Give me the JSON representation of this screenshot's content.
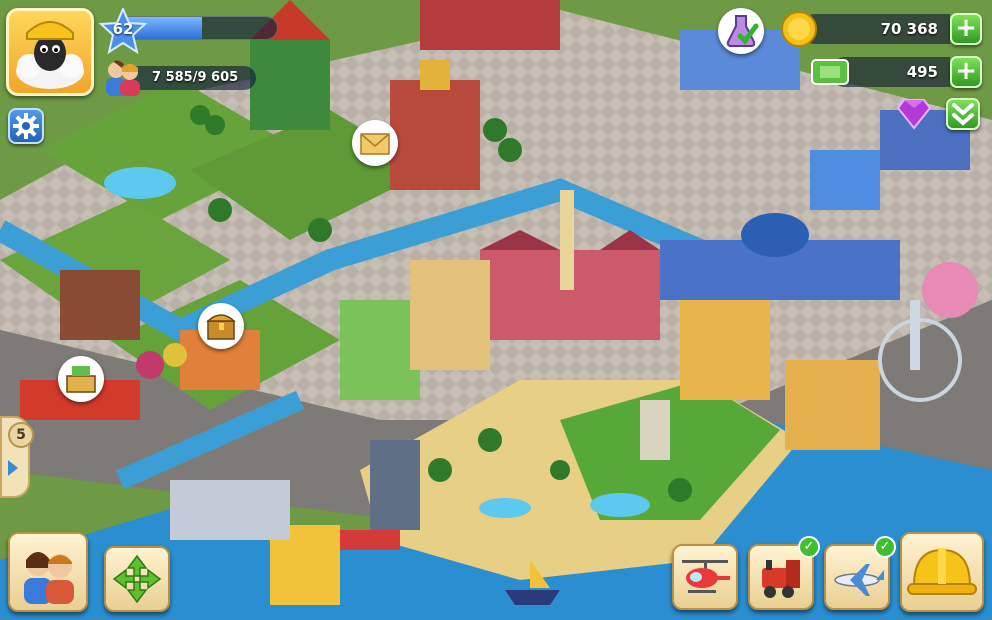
{
  "player": {
    "level": "62",
    "xp_progress": 0.5,
    "population": "7 585/9 605"
  },
  "resources": {
    "coins": "70 368",
    "cash": "495"
  },
  "side_panel": {
    "count": "5"
  },
  "icons": {
    "avatar": "sheep-avatar-icon",
    "settings": "gear-icon",
    "population": "people-icon",
    "coins": "gold-coin-icon",
    "cash": "banknote-icon",
    "research": "flask-check-icon",
    "gem": "purple-gem-icon",
    "mail": "envelope-icon",
    "chest": "treasure-chest-icon",
    "shop": "cash-register-icon",
    "friends": "friends-icon",
    "move": "move-arrows-icon",
    "helicopter": "helicopter-icon",
    "train": "train-icon",
    "airplane": "airplane-icon",
    "build": "hard-hat-icon"
  },
  "colors": {
    "plus_button": "#2f9a22",
    "settings_button": "#2463b8",
    "check_badge": "#3fbf2f"
  }
}
